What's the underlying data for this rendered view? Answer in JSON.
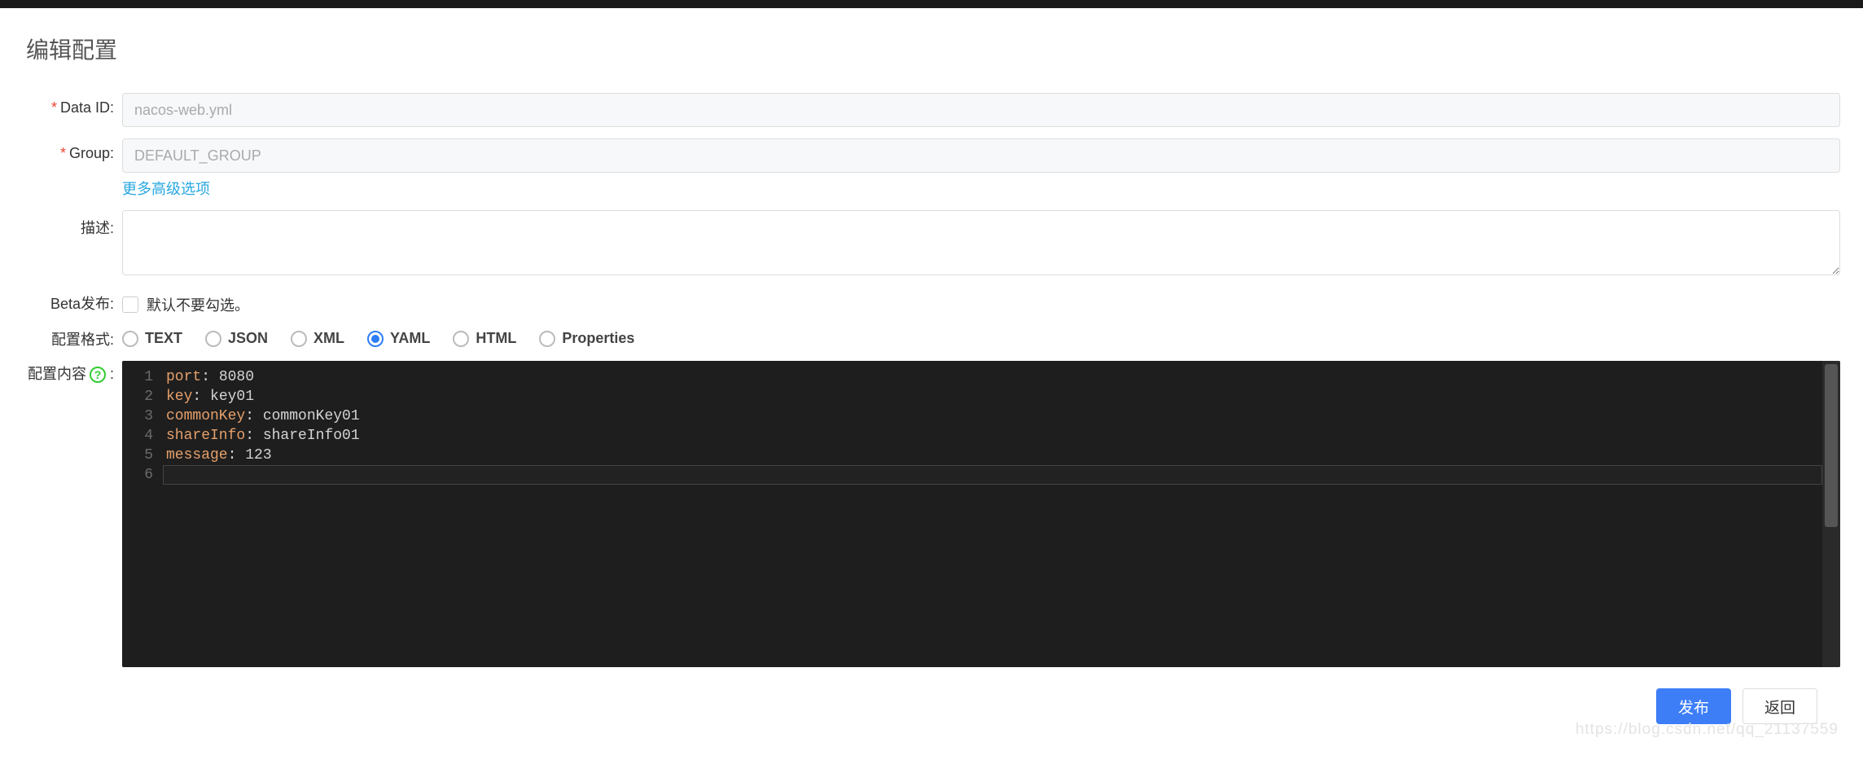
{
  "page": {
    "title": "编辑配置"
  },
  "form": {
    "dataId": {
      "label": "Data ID:",
      "value": "nacos-web.yml"
    },
    "group": {
      "label": "Group:",
      "value": "DEFAULT_GROUP"
    },
    "advancedLink": "更多高级选项",
    "desc": {
      "label": "描述:",
      "value": ""
    },
    "beta": {
      "label": "Beta发布:",
      "checkboxLabel": "默认不要勾选。",
      "checked": false
    },
    "format": {
      "label": "配置格式:",
      "options": [
        "TEXT",
        "JSON",
        "XML",
        "YAML",
        "HTML",
        "Properties"
      ],
      "selected": "YAML"
    },
    "content": {
      "label": "配置内容",
      "help": "?",
      "lines": [
        {
          "n": 1,
          "key": "port",
          "val": "8080",
          "valType": "num"
        },
        {
          "n": 2,
          "key": "key",
          "val": "key01",
          "valType": "str"
        },
        {
          "n": 3,
          "key": "commonKey",
          "val": "commonKey01",
          "valType": "str"
        },
        {
          "n": 4,
          "key": "shareInfo",
          "val": "shareInfo01",
          "valType": "str"
        },
        {
          "n": 5,
          "key": "message",
          "val": "123",
          "valType": "num"
        },
        {
          "n": 6,
          "key": "",
          "val": "",
          "valType": ""
        }
      ]
    }
  },
  "footer": {
    "publish": "发布",
    "back": "返回"
  },
  "watermark": "https://blog.csdn.net/qq_21137559"
}
